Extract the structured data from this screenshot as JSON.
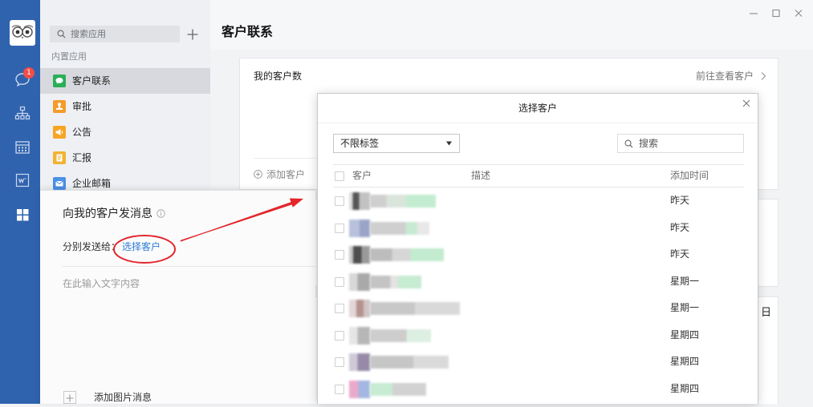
{
  "colors": {
    "sidebar": "#3063ae",
    "accent_link": "#2d7cd6",
    "annotation_red": "#e3262b",
    "badge_red": "#f24d47",
    "selected_row": "#d7d9de"
  },
  "window": {
    "controls": [
      "minimize-icon",
      "maximize-icon",
      "close-icon"
    ]
  },
  "sidebar": {
    "avatar_icon": "owl-avatar-icon",
    "items": [
      {
        "icon": "chat-icon",
        "badge": "1"
      },
      {
        "icon": "org-chart-icon"
      },
      {
        "icon": "calendar-icon"
      },
      {
        "icon": "document-icon"
      },
      {
        "icon": "apps-grid-icon",
        "active": true
      }
    ]
  },
  "app_list": {
    "search_placeholder": "搜索应用",
    "add_icon": "plus-icon",
    "section_label": "内置应用",
    "items": [
      {
        "label": "客户联系",
        "icon": "customer-contact-icon",
        "color": "#2aae57",
        "selected": true
      },
      {
        "label": "审批",
        "icon": "approval-icon",
        "color": "#f39c2b"
      },
      {
        "label": "公告",
        "icon": "announcement-icon",
        "color": "#f6a524"
      },
      {
        "label": "汇报",
        "icon": "report-icon",
        "color": "#f2b233"
      },
      {
        "label": "企业邮箱",
        "icon": "mail-icon",
        "color": "#4b8fe6"
      }
    ]
  },
  "main": {
    "title": "客户联系",
    "customer_card": {
      "title": "我的客户数",
      "view_link": "前往查看客户",
      "add_label": "添加客户"
    },
    "side_text": "日"
  },
  "message_panel": {
    "title": "向我的客户发消息",
    "send_to_label": "分别发送给：",
    "select_link": "选择客户",
    "input_placeholder": "在此输入文字内容",
    "add_image_label": "添加图片消息"
  },
  "dialog": {
    "title": "选择客户",
    "tag_filter": "不限标签",
    "search_placeholder": "搜索",
    "columns": {
      "customer": "客户",
      "description": "描述",
      "added": "添加时间"
    },
    "rows": [
      {
        "added": "昨天"
      },
      {
        "added": "昨天"
      },
      {
        "added": "昨天"
      },
      {
        "added": "星期一"
      },
      {
        "added": "星期一"
      },
      {
        "added": "星期四"
      },
      {
        "added": "星期四"
      },
      {
        "added": "星期四"
      }
    ]
  }
}
